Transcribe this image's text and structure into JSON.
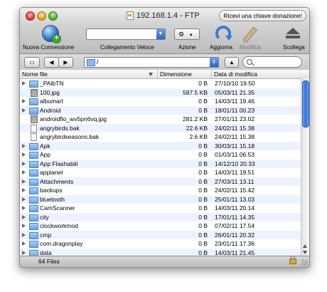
{
  "window": {
    "title": "192.168.1.4 - FTP",
    "donate_label": "Ricevi una chiave donazione!"
  },
  "toolbar": {
    "new_connection": "Nuova Connessione",
    "quick_connect": "Collegamento Veloce",
    "action": "Azione",
    "action_glyph": "⚙",
    "refresh": "Aggiorna",
    "edit": "Modifica",
    "disconnect": "Scollega"
  },
  "navbar": {
    "path": "/",
    "search_placeholder": ""
  },
  "columns": {
    "name": "Nome file",
    "size": "Dimensione",
    "date": "Data di modifica"
  },
  "files": [
    {
      "name": "_PAlbTN",
      "size": "0 B",
      "date": "27/10/10 19.50",
      "type": "folder"
    },
    {
      "name": "100.jpg",
      "size": "587.5 KB",
      "date": "05/03/11 21.35",
      "type": "image"
    },
    {
      "name": "albumart",
      "size": "0 B",
      "date": "14/03/11 19.46",
      "type": "folder"
    },
    {
      "name": "Android",
      "size": "0 B",
      "date": "18/01/11 00.23",
      "type": "folder"
    },
    {
      "name": "androidflo_wv5pn6vq.jpg",
      "size": "281.2 KB",
      "date": "27/01/11 23.02",
      "type": "image"
    },
    {
      "name": "angrybirds.bak",
      "size": "22.6 KB",
      "date": "24/02/11 15.38",
      "type": "file"
    },
    {
      "name": "angrybirdseasons.bak",
      "size": "2.6 KB",
      "date": "24/02/11 15.38",
      "type": "file"
    },
    {
      "name": "Apk",
      "size": "0 B",
      "date": "30/03/11 15.18",
      "type": "folder"
    },
    {
      "name": "App",
      "size": "0 B",
      "date": "01/03/11 06.53",
      "type": "folder"
    },
    {
      "name": "App Flashabili",
      "size": "0 B",
      "date": "14/12/10 20.33",
      "type": "folder"
    },
    {
      "name": "applanet",
      "size": "0 B",
      "date": "14/03/11 19.51",
      "type": "folder"
    },
    {
      "name": "Attachments",
      "size": "0 B",
      "date": "27/03/11 13.11",
      "type": "folder"
    },
    {
      "name": "backups",
      "size": "0 B",
      "date": "24/02/11 15.42",
      "type": "folder"
    },
    {
      "name": "bluetooth",
      "size": "0 B",
      "date": "25/01/11 13.03",
      "type": "folder"
    },
    {
      "name": "CamScanner",
      "size": "0 B",
      "date": "14/03/11 20.14",
      "type": "folder"
    },
    {
      "name": "city",
      "size": "0 B",
      "date": "17/01/11 14.35",
      "type": "folder"
    },
    {
      "name": "clockworkmod",
      "size": "0 B",
      "date": "07/02/11 17.54",
      "type": "folder"
    },
    {
      "name": "cmp",
      "size": "0 B",
      "date": "26/01/11 20.32",
      "type": "folder"
    },
    {
      "name": "com.dragonplay",
      "size": "0 B",
      "date": "23/01/11 17.36",
      "type": "folder"
    },
    {
      "name": "data",
      "size": "0 B",
      "date": "14/03/11 21.45",
      "type": "folder"
    }
  ],
  "status": {
    "count": "64 Files"
  }
}
